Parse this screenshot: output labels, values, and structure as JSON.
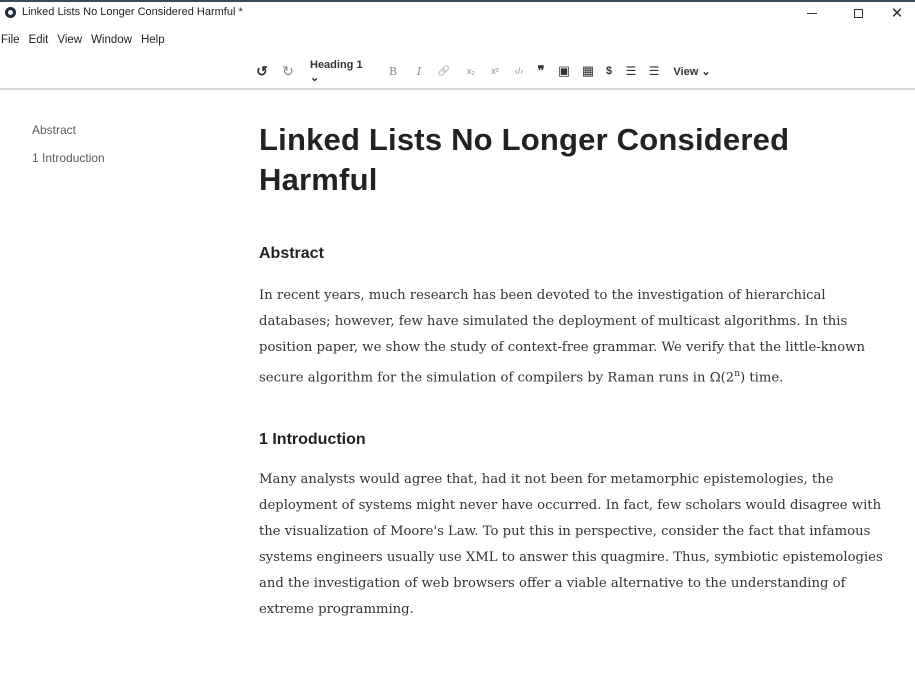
{
  "window": {
    "title": "Linked Lists No Longer Considered Harmful *",
    "controls": {
      "minimize": "—",
      "maximize": "☐",
      "close": "✕"
    }
  },
  "menu": [
    "File",
    "Edit",
    "View",
    "Window",
    "Help"
  ],
  "toolbar": {
    "undo": "↺",
    "redo": "↻",
    "heading": "Heading 1 ⌄",
    "bold": "B",
    "italic": "I",
    "link": "🔗",
    "subscript": "x₂",
    "superscript": "x²",
    "code": "‹/›",
    "quote": "❞",
    "image": "▣",
    "table": "▦",
    "math": "$",
    "bullet_list": "☰",
    "numbered_list": "☰",
    "view": "View ⌄"
  },
  "outline": [
    "Abstract",
    "1 Introduction"
  ],
  "document": {
    "title": "Linked Lists No Longer Considered Harmful",
    "abstract_heading": "Abstract",
    "abstract_text_before_sup": "In recent years, much research has been devoted to the investigation of hierarchical databases; however, few have simulated the deployment of multicast algorithms. In this position paper, we show the study of context-free grammar. We verify that the little-known secure algorithm for the simulation of compilers by Raman runs in Ω(2",
    "abstract_sup": "n",
    "abstract_text_after_sup": ") time.",
    "intro_heading": "1 Introduction",
    "intro_text": "Many analysts would agree that, had it not been for metamorphic epistemologies, the deployment of systems might never have occurred. In fact, few scholars would disagree with the visualization of Moore's Law. To put this in perspective, consider the fact that infamous systems engineers usually use XML to answer this quagmire. Thus, symbiotic epistemologies and the investigation of web browsers offer a viable alternative to the understanding of extreme programming."
  }
}
